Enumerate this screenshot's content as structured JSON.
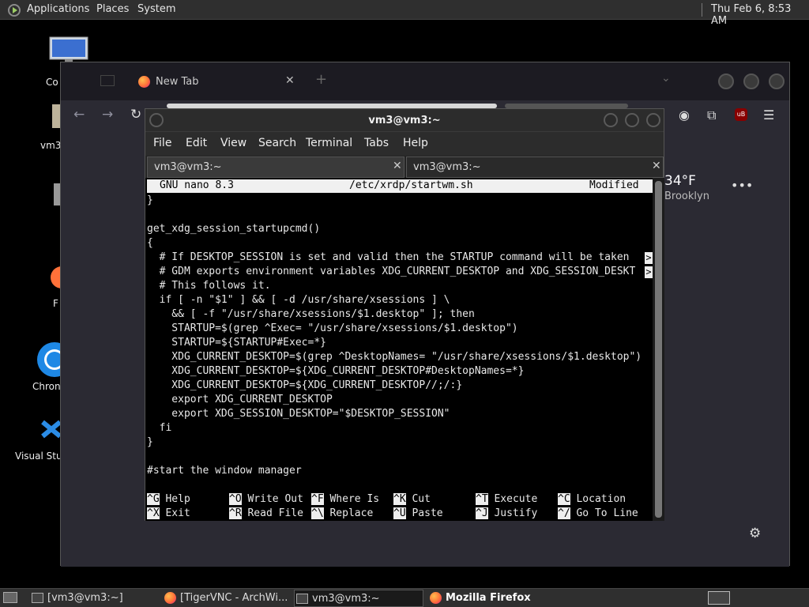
{
  "top_panel": {
    "menus": [
      "Applications",
      "Places",
      "System"
    ],
    "clock": "Thu Feb  6,  8:53 AM"
  },
  "desktop_icons": [
    {
      "label": "Co",
      "icon": "computer-icon"
    },
    {
      "label": "vm3",
      "icon": "home-folder-icon"
    },
    {
      "label": "",
      "icon": "trash-icon"
    },
    {
      "label": "F",
      "icon": "firefox-icon"
    },
    {
      "label": "Chron",
      "icon": "chromium-icon"
    },
    {
      "label": "Visual Stu",
      "icon": "vscode-icon"
    }
  ],
  "firefox": {
    "tab_title": "New Tab",
    "weather": {
      "temp": "34°F",
      "location": "Brooklyn"
    },
    "extension_badge": "uB"
  },
  "terminal": {
    "title": "vm3@vm3:~",
    "menu": [
      "File",
      "Edit",
      "View",
      "Search",
      "Terminal",
      "Tabs",
      "Help"
    ],
    "tabs": [
      "vm3@vm3:~",
      "vm3@vm3:~"
    ],
    "nano": {
      "version": "GNU nano 8.3",
      "file": "/etc/xrdp/startwm.sh",
      "status": "Modified"
    },
    "lines": [
      "}",
      "",
      "get_xdg_session_startupcmd()",
      "{",
      "  # If DESKTOP_SESSION is set and valid then the STARTUP command will be taken ",
      "  # GDM exports environment variables XDG_CURRENT_DESKTOP and XDG_SESSION_DESKT",
      "  # This follows it.",
      "  if [ -n \"$1\" ] && [ -d /usr/share/xsessions ] \\",
      "    && [ -f \"/usr/share/xsessions/$1.desktop\" ]; then",
      "    STARTUP=$(grep ^Exec= \"/usr/share/xsessions/$1.desktop\")",
      "    STARTUP=${STARTUP#Exec=*}",
      "    XDG_CURRENT_DESKTOP=$(grep ^DesktopNames= \"/usr/share/xsessions/$1.desktop\")",
      "    XDG_CURRENT_DESKTOP=${XDG_CURRENT_DESKTOP#DesktopNames=*}",
      "    XDG_CURRENT_DESKTOP=${XDG_CURRENT_DESKTOP//;/:}",
      "    export XDG_CURRENT_DESKTOP",
      "    export XDG_SESSION_DESKTOP=\"$DESKTOP_SESSION\"",
      "  fi",
      "}",
      "",
      "#start the window manager"
    ],
    "overflow_marker": ">",
    "shortcuts_row1": [
      {
        "key": "^G",
        "label": "Help"
      },
      {
        "key": "^O",
        "label": "Write Out"
      },
      {
        "key": "^F",
        "label": "Where Is"
      },
      {
        "key": "^K",
        "label": "Cut"
      },
      {
        "key": "^T",
        "label": "Execute"
      },
      {
        "key": "^C",
        "label": "Location"
      }
    ],
    "shortcuts_row2": [
      {
        "key": "^X",
        "label": "Exit"
      },
      {
        "key": "^R",
        "label": "Read File"
      },
      {
        "key": "^\\",
        "label": "Replace"
      },
      {
        "key": "^U",
        "label": "Paste"
      },
      {
        "key": "^J",
        "label": "Justify"
      },
      {
        "key": "^/",
        "label": "Go To Line"
      }
    ]
  },
  "taskbar": {
    "items": [
      {
        "label": "[vm3@vm3:~]",
        "icon": "terminal-icon"
      },
      {
        "label": "[TigerVNC - ArchWi...",
        "icon": "firefox-icon"
      },
      {
        "label": "vm3@vm3:~",
        "icon": "terminal-icon"
      },
      {
        "label": "Mozilla Firefox",
        "icon": "firefox-icon"
      }
    ]
  }
}
